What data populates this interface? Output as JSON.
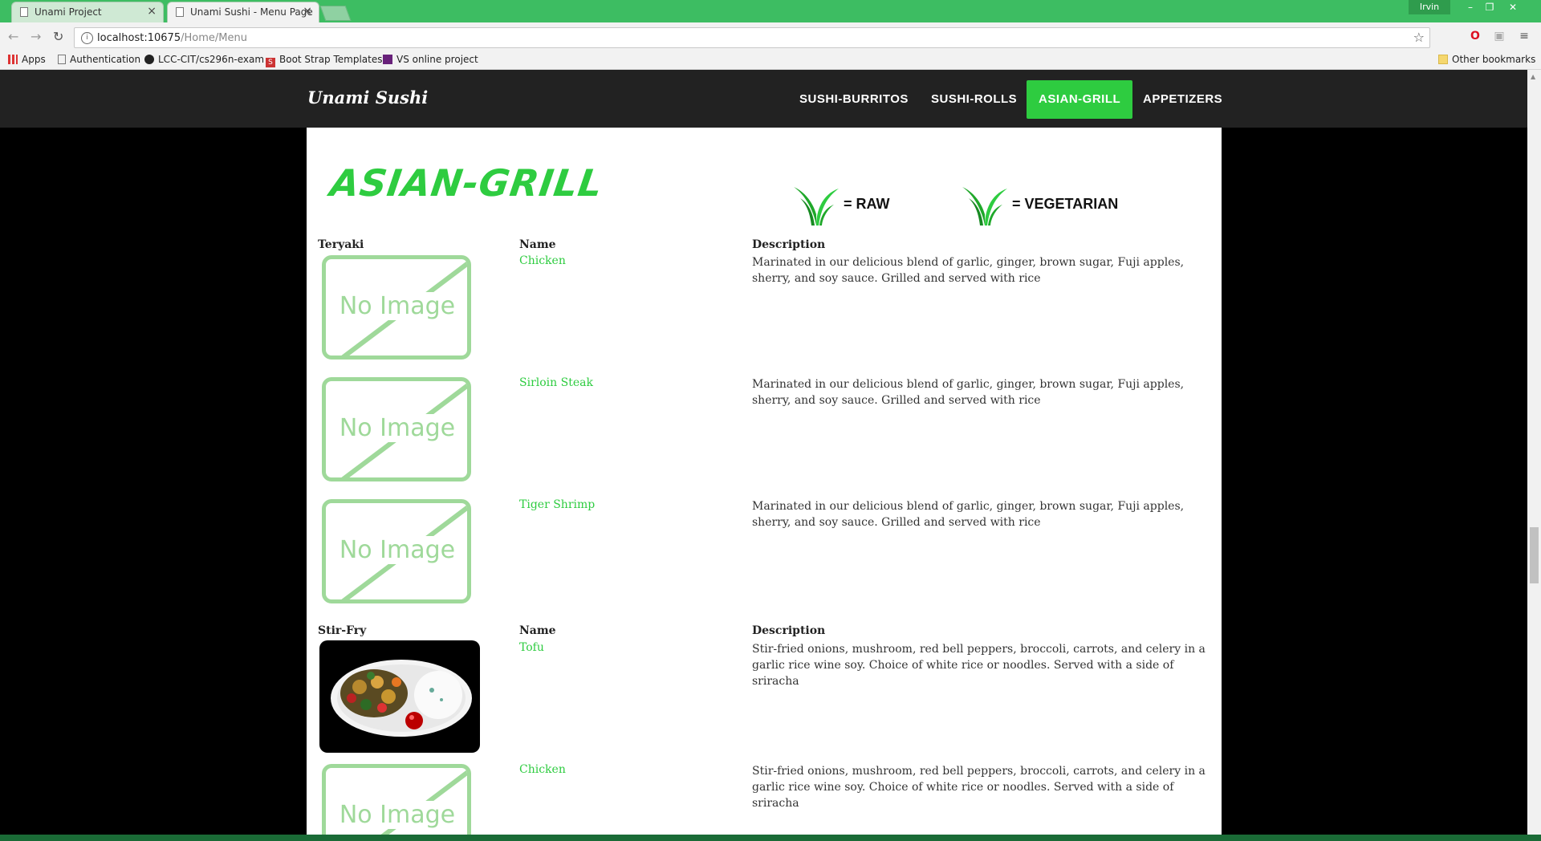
{
  "browser": {
    "tabs": [
      {
        "title": "Unami Project"
      },
      {
        "title": "Unami Sushi - Menu Page"
      }
    ],
    "user": "Irvin",
    "url_host": "localhost:10675",
    "url_path": "/Home/Menu",
    "bookmarks": [
      {
        "label": "Apps",
        "icon": "apps-grid-icon"
      },
      {
        "label": "Authentication",
        "icon": "page-icon"
      },
      {
        "label": "LCC-CIT/cs296n-exam",
        "icon": "github-icon"
      },
      {
        "label": "Boot Strap Templates",
        "icon": "s-logo-icon"
      },
      {
        "label": "VS online project",
        "icon": "visual-studio-icon"
      }
    ],
    "other_bookmarks": "Other bookmarks"
  },
  "site": {
    "brand": "Unami Sushi",
    "nav": [
      {
        "label": "SUSHI-BURRITOS",
        "active": false
      },
      {
        "label": "SUSHI-ROLLS",
        "active": false
      },
      {
        "label": "ASIAN-GRILL",
        "active": true
      },
      {
        "label": "APPETIZERS",
        "active": false
      }
    ],
    "accent_color": "#2ecc40"
  },
  "page": {
    "title": "ASIAN-GRILL",
    "legend": [
      {
        "icon": "grass-leaf-icon",
        "text": "= RAW"
      },
      {
        "icon": "grass-leaf-icon",
        "text": "= VEGETARIAN"
      }
    ],
    "no_image_text": "No Image",
    "sections": [
      {
        "category": "Teryaki",
        "name_header": "Name",
        "desc_header": "Description",
        "items": [
          {
            "name": "Chicken",
            "description": "Marinated in our delicious blend of garlic, ginger, brown sugar, Fuji apples, sherry, and soy sauce. Grilled and served with rice",
            "image": "none"
          },
          {
            "name": "Sirloin Steak",
            "description": "Marinated in our delicious blend of garlic, ginger, brown sugar, Fuji apples, sherry, and soy sauce. Grilled and served with rice",
            "image": "none"
          },
          {
            "name": "Tiger Shrimp",
            "description": "Marinated in our delicious blend of garlic, ginger, brown sugar, Fuji apples, sherry, and soy sauce. Grilled and served with rice",
            "image": "none"
          }
        ]
      },
      {
        "category": "Stir-Fry",
        "name_header": "Name",
        "desc_header": "Description",
        "items": [
          {
            "name": "Tofu",
            "description": "Stir-fried onions, mushroom, red bell peppers, broccoli, carrots, and celery in a garlic rice wine soy. Choice of white rice or noodles. Served with a side of sriracha",
            "image": "photo"
          },
          {
            "name": "Chicken",
            "description": "Stir-fried onions, mushroom, red bell peppers, broccoli, carrots, and celery in a garlic rice wine soy. Choice of white rice or noodles. Served with a side of sriracha",
            "image": "none"
          }
        ]
      }
    ]
  }
}
